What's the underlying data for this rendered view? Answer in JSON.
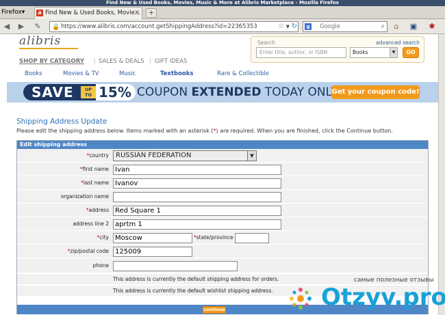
{
  "browser": {
    "title": "Find New & Used Books, Movies, Music & More at Alibris Marketplace - Mozilla Firefox",
    "menu": "Firefox",
    "tab_title": "Find New & Used Books, Movie...",
    "tab_favicon": "a",
    "url": "https://www.alibris.com/account.getShippingAddress?id=22365353",
    "url_domain": "alibris.com",
    "search_engine_placeholder": "Google"
  },
  "site": {
    "logo": "alibris",
    "category_nav": [
      "SHOP BY CATEGORY",
      "SALES & DEALS",
      "GIFT IDEAS"
    ],
    "sub_nav": [
      "Books",
      "Movies & TV",
      "Music",
      "Textbooks",
      "Rare & Collectible"
    ],
    "search": {
      "label": "Search",
      "advanced": "advanced search",
      "placeholder": "Enter title, author, or ISBN",
      "category": "Books",
      "go": "GO"
    },
    "banner": {
      "save": "SAVE",
      "upto": "UP TO",
      "percent": "15%",
      "text_pre": "COUPON ",
      "text_bold": "EXTENDED",
      "text_post": " TODAY ONLY",
      "cta": "Get your coupon code!"
    }
  },
  "form": {
    "title": "Shipping Address Update",
    "instructions_pre": "Please edit the shipping address below. Items marked with an asterisk (",
    "asterisk": "*",
    "instructions_post": ") are required. When you are finished, click the Continue button.",
    "section_header": "Edit shipping address",
    "fields": {
      "country": {
        "label": "country",
        "value": "RUSSIAN FEDERATION"
      },
      "first_name": {
        "label": "first name",
        "value": "Ivan"
      },
      "last_name": {
        "label": "last name",
        "value": "Ivanov"
      },
      "organization": {
        "label": "organization name",
        "value": ""
      },
      "address": {
        "label": "address",
        "value": "Red Square 1"
      },
      "address2": {
        "label": "address line 2",
        "value": "aprtm 1"
      },
      "city": {
        "label": "city",
        "value": "Moscow"
      },
      "state": {
        "label": "state/province",
        "value": ""
      },
      "zip": {
        "label": "zip/postal code",
        "value": "125009"
      },
      "phone": {
        "label": "phone",
        "value": ""
      }
    },
    "note_shipping": "This address is currently the default shipping address for orders.",
    "note_wishlist": "This address is currently the default wishlist shipping address.",
    "continue": "continue"
  },
  "watermark": {
    "tagline": "самые полезные отзывы",
    "logo": "Otzyv.pro"
  },
  "colors": {
    "brand_blue": "#2c5aa0",
    "accent_orange": "#f39a1e",
    "header_blue": "#4f86c6",
    "required_red": "#cc0000"
  }
}
